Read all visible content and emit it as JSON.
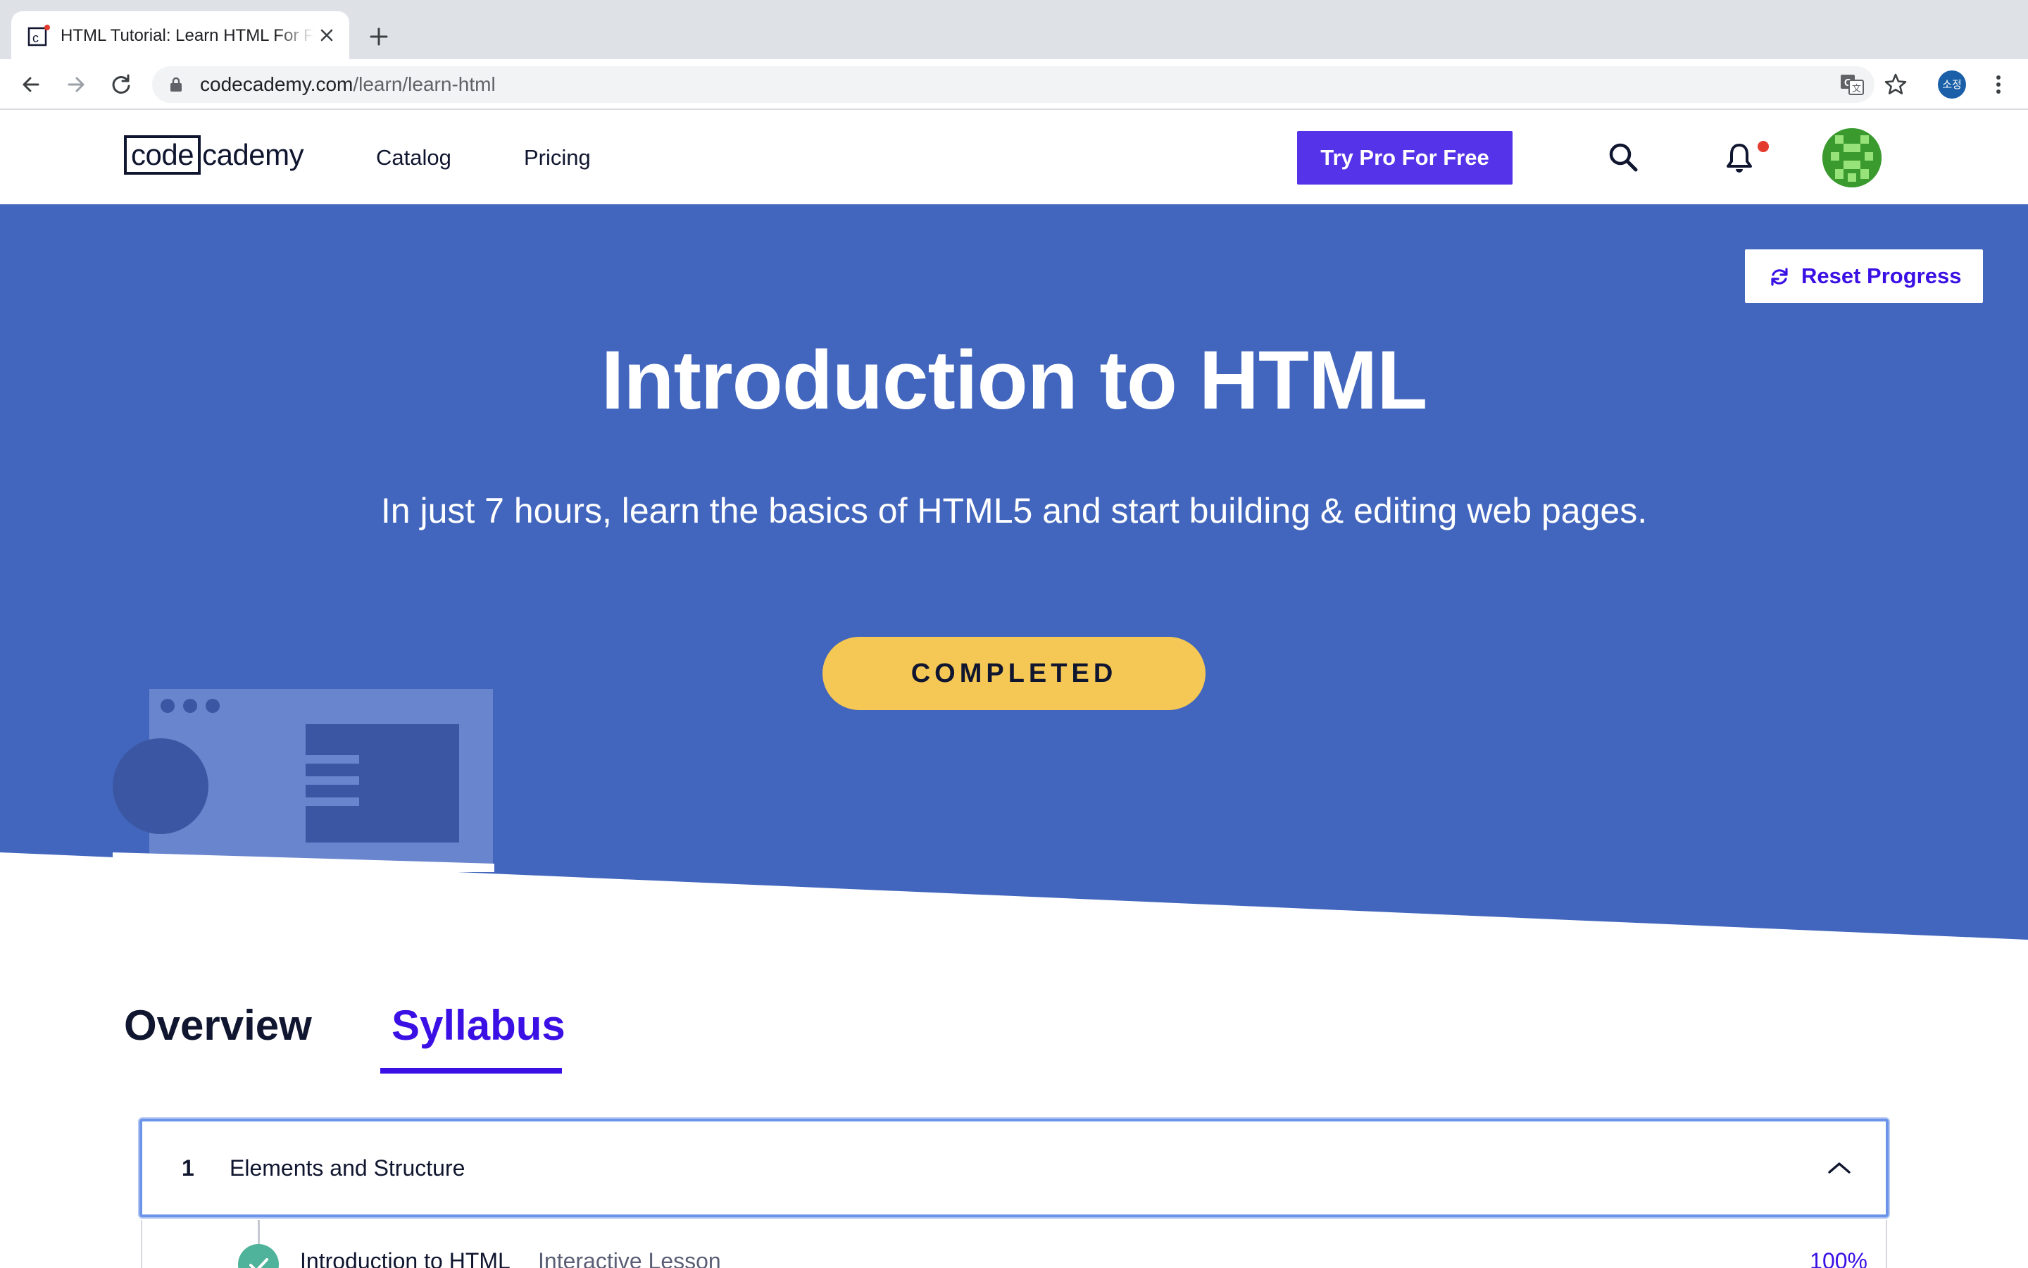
{
  "browser": {
    "tab_title": "HTML Tutorial: Learn HTML For Free | Codecademy",
    "url_host": "codecademy.com",
    "url_path": "/learn/learn-html",
    "profile_initials": "소정"
  },
  "header": {
    "logo_box": "code",
    "logo_rest": "cademy",
    "nav": [
      "Catalog",
      "Pricing"
    ],
    "pro_button": "Try Pro For Free"
  },
  "hero": {
    "reset_button": "Reset Progress",
    "title": "Introduction to HTML",
    "subtitle": "In just 7 hours, learn the basics of HTML5 and start building & editing web pages.",
    "status_button": "COMPLETED"
  },
  "tabs": {
    "overview": "Overview",
    "syllabus": "Syllabus",
    "active": "Syllabus"
  },
  "syllabus": {
    "modules": [
      {
        "number": "1",
        "title": "Elements and Structure",
        "lessons": [
          {
            "name": "Introduction to HTML",
            "type": "Interactive Lesson",
            "progress": "100%"
          }
        ]
      }
    ]
  },
  "colors": {
    "hero_blue": "#4266bd",
    "brand_purple": "#3a10e5",
    "pro_button": "#5533e8",
    "completed_yellow": "#f5c754",
    "check_green": "#4eb39a"
  },
  "icons": [
    "back-icon",
    "forward-icon",
    "reload-icon",
    "lock-icon",
    "translate-icon",
    "star-icon",
    "menu-icon",
    "search-icon",
    "bell-icon",
    "refresh-icon",
    "chevron-up-icon",
    "check-icon"
  ]
}
